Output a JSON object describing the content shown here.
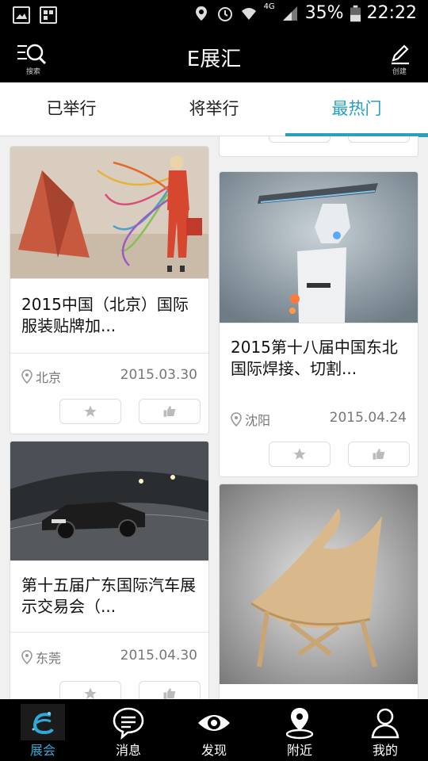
{
  "status_bar": {
    "battery": "35%",
    "time": "22:22",
    "network": "4G"
  },
  "header": {
    "title": "E展汇",
    "search_caption": "搜索",
    "create_caption": "创建"
  },
  "tabs": [
    {
      "label": "已举行"
    },
    {
      "label": "将举行"
    },
    {
      "label": "最热门"
    }
  ],
  "cards": [
    {
      "title": "2015中国（北京）国际服装贴牌加...",
      "location": "北京",
      "date": "2015.03.30"
    },
    {
      "title": "2015第十八届中国东北国际焊接、切割...",
      "location": "沈阳",
      "date": "2015.04.24"
    },
    {
      "title": "第十五届广东国际汽车展示交易会（...",
      "location": "东莞",
      "date": "2015.04.30"
    }
  ],
  "bottom_nav": [
    {
      "label": "展会"
    },
    {
      "label": "消息"
    },
    {
      "label": "发现"
    },
    {
      "label": "附近"
    },
    {
      "label": "我的"
    }
  ],
  "colors": {
    "accent": "#2a9fbf",
    "bar": "#000000"
  }
}
